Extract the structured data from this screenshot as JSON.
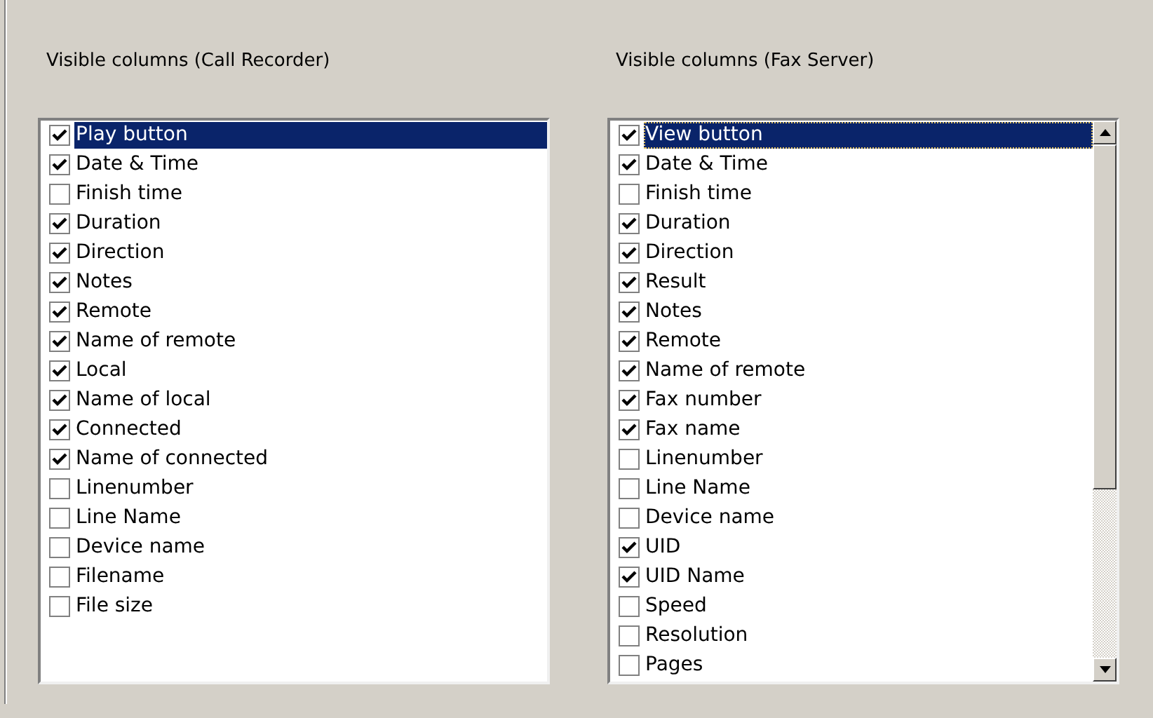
{
  "lists": [
    {
      "title": "Visible columns (Call Recorder)",
      "focused": false,
      "scrollbar": false,
      "items": [
        {
          "label": "Play button",
          "checked": true,
          "selected": true
        },
        {
          "label": "Date & Time",
          "checked": true,
          "selected": false
        },
        {
          "label": "Finish time",
          "checked": false,
          "selected": false
        },
        {
          "label": "Duration",
          "checked": true,
          "selected": false
        },
        {
          "label": "Direction",
          "checked": true,
          "selected": false
        },
        {
          "label": "Notes",
          "checked": true,
          "selected": false
        },
        {
          "label": "Remote",
          "checked": true,
          "selected": false
        },
        {
          "label": "Name of remote",
          "checked": true,
          "selected": false
        },
        {
          "label": "Local",
          "checked": true,
          "selected": false
        },
        {
          "label": "Name of local",
          "checked": true,
          "selected": false
        },
        {
          "label": "Connected",
          "checked": true,
          "selected": false
        },
        {
          "label": "Name of connected",
          "checked": true,
          "selected": false
        },
        {
          "label": "Linenumber",
          "checked": false,
          "selected": false
        },
        {
          "label": "Line Name",
          "checked": false,
          "selected": false
        },
        {
          "label": "Device name",
          "checked": false,
          "selected": false
        },
        {
          "label": "Filename",
          "checked": false,
          "selected": false
        },
        {
          "label": "File size",
          "checked": false,
          "selected": false
        }
      ]
    },
    {
      "title": "Visible columns (Fax Server)",
      "focused": true,
      "scrollbar": true,
      "items": [
        {
          "label": "View button",
          "checked": true,
          "selected": true
        },
        {
          "label": "Date & Time",
          "checked": true,
          "selected": false
        },
        {
          "label": "Finish time",
          "checked": false,
          "selected": false
        },
        {
          "label": "Duration",
          "checked": true,
          "selected": false
        },
        {
          "label": "Direction",
          "checked": true,
          "selected": false
        },
        {
          "label": "Result",
          "checked": true,
          "selected": false
        },
        {
          "label": "Notes",
          "checked": true,
          "selected": false
        },
        {
          "label": "Remote",
          "checked": true,
          "selected": false
        },
        {
          "label": "Name of remote",
          "checked": true,
          "selected": false
        },
        {
          "label": "Fax number",
          "checked": true,
          "selected": false
        },
        {
          "label": "Fax name",
          "checked": true,
          "selected": false
        },
        {
          "label": "Linenumber",
          "checked": false,
          "selected": false
        },
        {
          "label": "Line Name",
          "checked": false,
          "selected": false
        },
        {
          "label": "Device name",
          "checked": false,
          "selected": false
        },
        {
          "label": "UID",
          "checked": true,
          "selected": false
        },
        {
          "label": "UID Name",
          "checked": true,
          "selected": false
        },
        {
          "label": "Speed",
          "checked": false,
          "selected": false
        },
        {
          "label": "Resolution",
          "checked": false,
          "selected": false
        },
        {
          "label": "Pages",
          "checked": false,
          "selected": false
        }
      ]
    }
  ]
}
